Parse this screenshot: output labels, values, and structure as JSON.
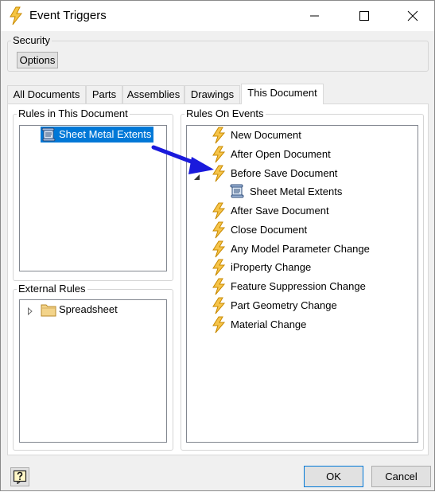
{
  "window": {
    "title": "Event Triggers",
    "icon": "lightning-bolt-icon"
  },
  "caption_buttons": [
    "minimize-icon",
    "maximize-icon",
    "close-icon"
  ],
  "security": {
    "legend": "Security",
    "options_label": "Options"
  },
  "tabs": [
    {
      "label": "All Documents",
      "active": false
    },
    {
      "label": "Parts",
      "active": false
    },
    {
      "label": "Assemblies",
      "active": false
    },
    {
      "label": "Drawings",
      "active": false
    },
    {
      "label": "This Document",
      "active": true
    }
  ],
  "rules_in_document": {
    "legend": "Rules in This Document",
    "items": [
      {
        "label": "Sheet Metal Extents",
        "icon": "rule-scroll-icon",
        "selected": true
      }
    ]
  },
  "external_rules": {
    "legend": "External Rules",
    "items": [
      {
        "label": "Spreadsheet",
        "icon": "folder-icon",
        "expander": "expand-arrow-icon"
      }
    ]
  },
  "rules_on_events": {
    "legend": "Rules On Events",
    "events": [
      {
        "label": "New Document",
        "icon": "lightning-bolt-icon"
      },
      {
        "label": "After Open Document",
        "icon": "lightning-bolt-icon"
      },
      {
        "label": "Before Save Document",
        "icon": "lightning-bolt-icon",
        "children": [
          {
            "label": "Sheet Metal Extents",
            "icon": "rule-scroll-icon"
          }
        ]
      },
      {
        "label": "After Save Document",
        "icon": "lightning-bolt-icon"
      },
      {
        "label": "Close Document",
        "icon": "lightning-bolt-icon"
      },
      {
        "label": "Any Model Parameter Change",
        "icon": "lightning-bolt-icon"
      },
      {
        "label": "iProperty Change",
        "icon": "lightning-bolt-icon"
      },
      {
        "label": "Feature Suppression Change",
        "icon": "lightning-bolt-icon"
      },
      {
        "label": "Part Geometry Change",
        "icon": "lightning-bolt-icon"
      },
      {
        "label": "Material Change",
        "icon": "lightning-bolt-icon"
      }
    ]
  },
  "footer": {
    "help_icon": "help-question-icon",
    "ok_label": "OK",
    "cancel_label": "Cancel"
  },
  "colors": {
    "selection": "#0078d7",
    "annotation_arrow": "#1a1adc",
    "bolt": "#f5b400"
  }
}
